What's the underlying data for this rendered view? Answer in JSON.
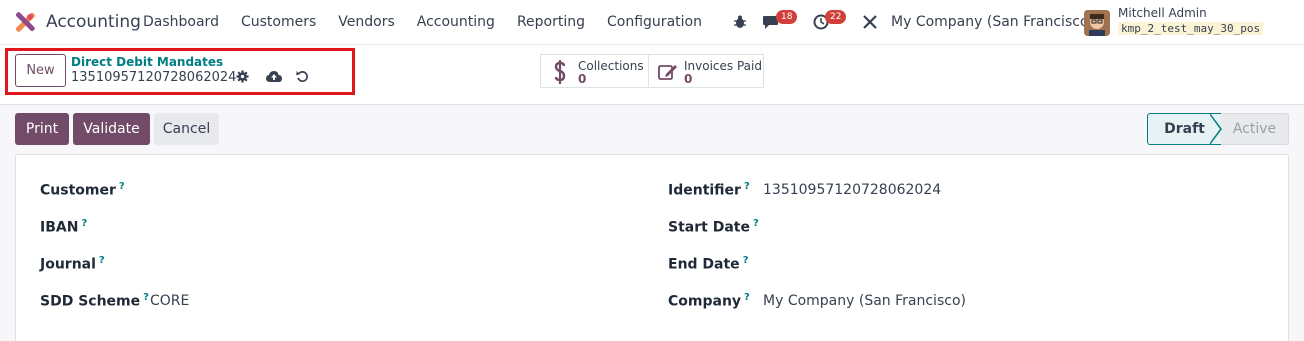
{
  "navbar": {
    "app_name": "Accounting",
    "menu": [
      "Dashboard",
      "Customers",
      "Vendors",
      "Accounting",
      "Reporting",
      "Configuration"
    ],
    "messages_badge": "18",
    "activities_badge": "22",
    "company": "My Company (San Francisco)",
    "user_name": "Mitchell Admin",
    "db_name": "kmp_2_test_may_30_pos"
  },
  "control": {
    "new_label": "New",
    "breadcrumb_parent": "Direct Debit Mandates",
    "record_name": "13510957120728062024",
    "smart_buttons": [
      {
        "label": "Collections",
        "value": "0",
        "icon": "dollar-icon"
      },
      {
        "label": "Invoices Paid",
        "value": "0",
        "icon": "edit-icon"
      }
    ]
  },
  "actions": {
    "print": "Print",
    "validate": "Validate",
    "cancel": "Cancel"
  },
  "status": {
    "steps": [
      "Draft",
      "Active"
    ],
    "current": "Draft"
  },
  "form": {
    "left": [
      {
        "label": "Customer",
        "value": ""
      },
      {
        "label": "IBAN",
        "value": ""
      },
      {
        "label": "Journal",
        "value": ""
      },
      {
        "label": "SDD Scheme",
        "value": "CORE"
      }
    ],
    "right": [
      {
        "label": "Identifier",
        "value": "13510957120728062024"
      },
      {
        "label": "Start Date",
        "value": ""
      },
      {
        "label": "End Date",
        "value": ""
      },
      {
        "label": "Company",
        "value": "My Company (San Francisco)"
      }
    ],
    "help_mark": "?"
  },
  "colors": {
    "brand": "#714b67",
    "link": "#017e84",
    "highlight": "#e0161d",
    "badge": "#d23f3a"
  }
}
